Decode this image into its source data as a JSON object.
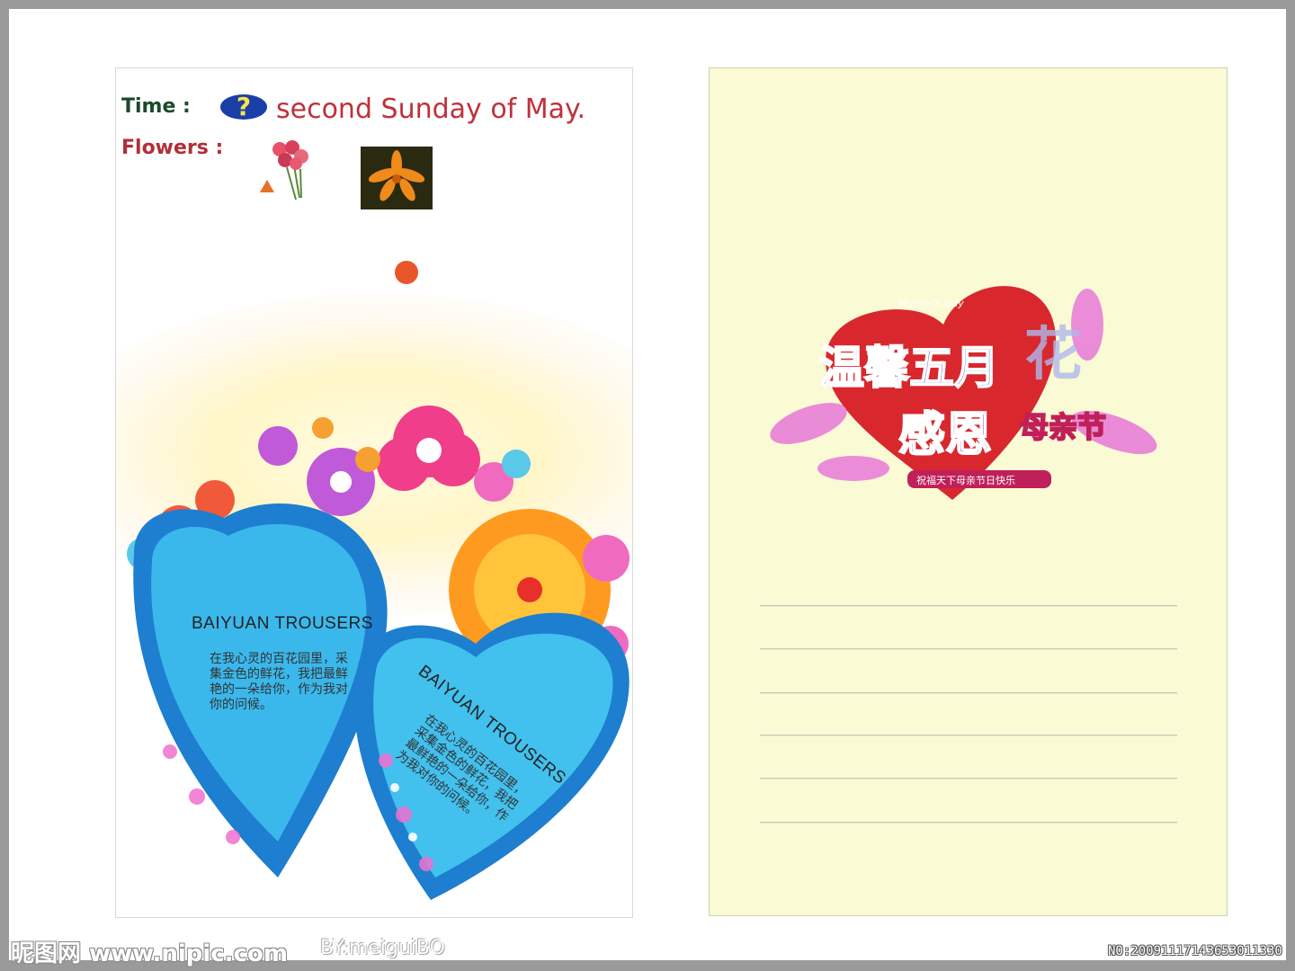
{
  "left_card": {
    "time_label": "Time :",
    "time_value": "second Sunday of May.",
    "flowers_label": "Flowers :",
    "heart_1": {
      "title": "BAIYUAN TROUSERS",
      "verse": "在我心灵的百花园里，采集金色的鲜花，我把最鲜艳的一朵给你，作为我对你的问候。"
    },
    "heart_2": {
      "title": "BAIYUAN TROUSERS",
      "verse": "在我心灵的百花园里，采集金色的鲜花，我把最鲜艳的一朵给你，作为我对你的问候。"
    }
  },
  "right_card": {
    "banner": {
      "small_label": "Mother's Day",
      "line_1": "温馨五月",
      "flower_char": "花",
      "line_2": "感恩",
      "line_3": "母亲节",
      "ribbon": "祝福天下母亲节日快乐"
    },
    "ruled_lines": 6
  },
  "watermark": {
    "site": "昵图网 www.nipic.com",
    "author": "BY:meiguiBO",
    "number": "NO:20091117143653011330"
  },
  "colors": {
    "time_label": "#1a4a2a",
    "flowers_label": "#b0303a",
    "time_value": "#c0303a",
    "right_card_bg": "#fafad5",
    "heart_blue": "#2a9ad8"
  }
}
